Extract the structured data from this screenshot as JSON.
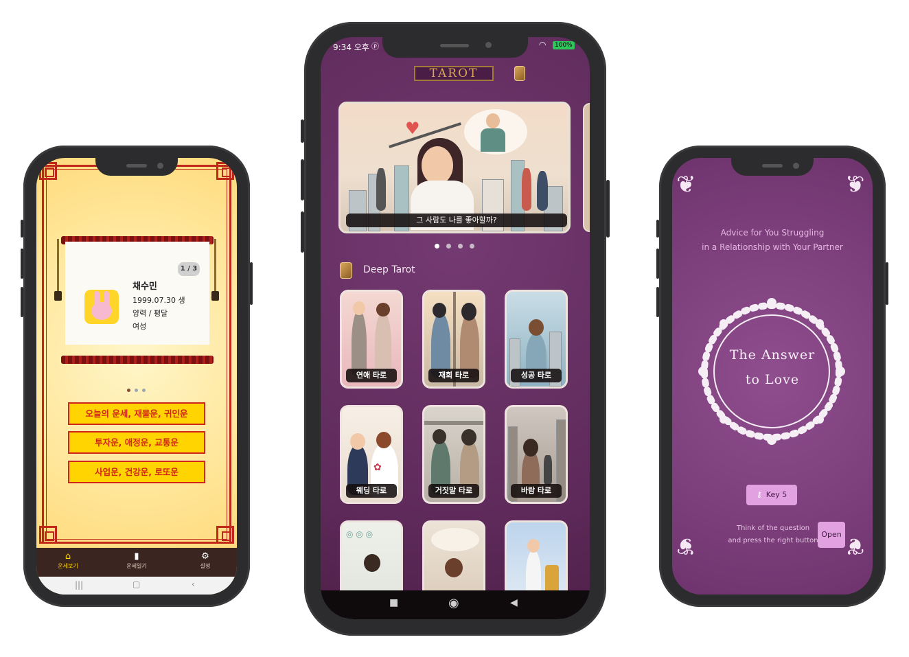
{
  "fortune_app": {
    "profile": {
      "page_indicator": "1 / 3",
      "name": "채수민",
      "birth": "1999.07.30 생",
      "calendar": "양력 / 평달",
      "gender": "여성"
    },
    "buttons": [
      "오늘의 운세, 재물운, 귀인운",
      "투자운, 애정운, 교통운",
      "사업운, 건강운, 로또운"
    ],
    "nav": [
      {
        "label": "운세보기",
        "icon": "home-icon"
      },
      {
        "label": "운세일기",
        "icon": "diary-icon"
      },
      {
        "label": "설정",
        "icon": "gear-icon"
      }
    ],
    "colors": {
      "background": "#ffe089",
      "frame": "#c0281a",
      "button": "#ffd400",
      "button_text": "#d0261a",
      "nav": "#3a2520"
    }
  },
  "tarot_app": {
    "status": {
      "time": "9:34 오후",
      "battery": "100%"
    },
    "title": "TAROT",
    "banner_caption": "그 사람도 나를 좋아할까?",
    "section_title": "Deep Tarot",
    "cards": [
      "연애 타로",
      "재회 타로",
      "성공 타로",
      "웨딩 타로",
      "거짓말 타로",
      "바람 타로"
    ],
    "colors": {
      "background": "#5e2a5a",
      "title_gold": "#d8a657"
    }
  },
  "answer_app": {
    "subtitle_line1": "Advice for You Struggling",
    "subtitle_line2": "in a Relationship with Your Partner",
    "title_line1": "The Answer",
    "title_line2": "to Love",
    "key_label": "Key 5",
    "instruction_line1": "Think of the question",
    "instruction_line2": "and press the right button",
    "open_label": "Open",
    "colors": {
      "background": "#7d3f7c",
      "button": "#e2a2e2"
    }
  }
}
